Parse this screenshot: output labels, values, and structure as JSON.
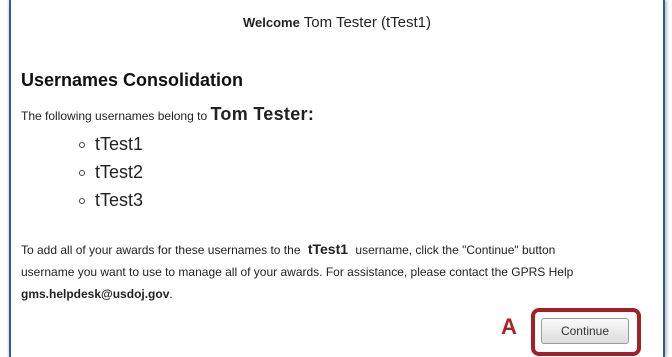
{
  "header": {
    "welcome_label": "Welcome",
    "user_name": "Tom Tester",
    "user_id": "(tTest1)"
  },
  "main": {
    "title": "Usernames Consolidation",
    "intro_text": "The following usernames belong to",
    "owner_name": "Tom Tester:",
    "usernames": [
      "tTest1",
      "tTest2",
      "tTest3"
    ],
    "instructions": {
      "line1_before": "To add all of your awards for these usernames to the",
      "line1_username": "tTest1",
      "line1_after": "username, click the \"Continue\" button",
      "line2": "username you want to use to manage all of your awards. For assistance, please contact the GPRS Help",
      "email": "gms.helpdesk@usdoj.gov",
      "email_suffix": "."
    },
    "continue_label": "Continue"
  },
  "annotation": {
    "marker": "A",
    "highlight_color": "#a32027"
  },
  "colors": {
    "frame_border": "#2d5d9c",
    "annotation": "#b0222a"
  }
}
